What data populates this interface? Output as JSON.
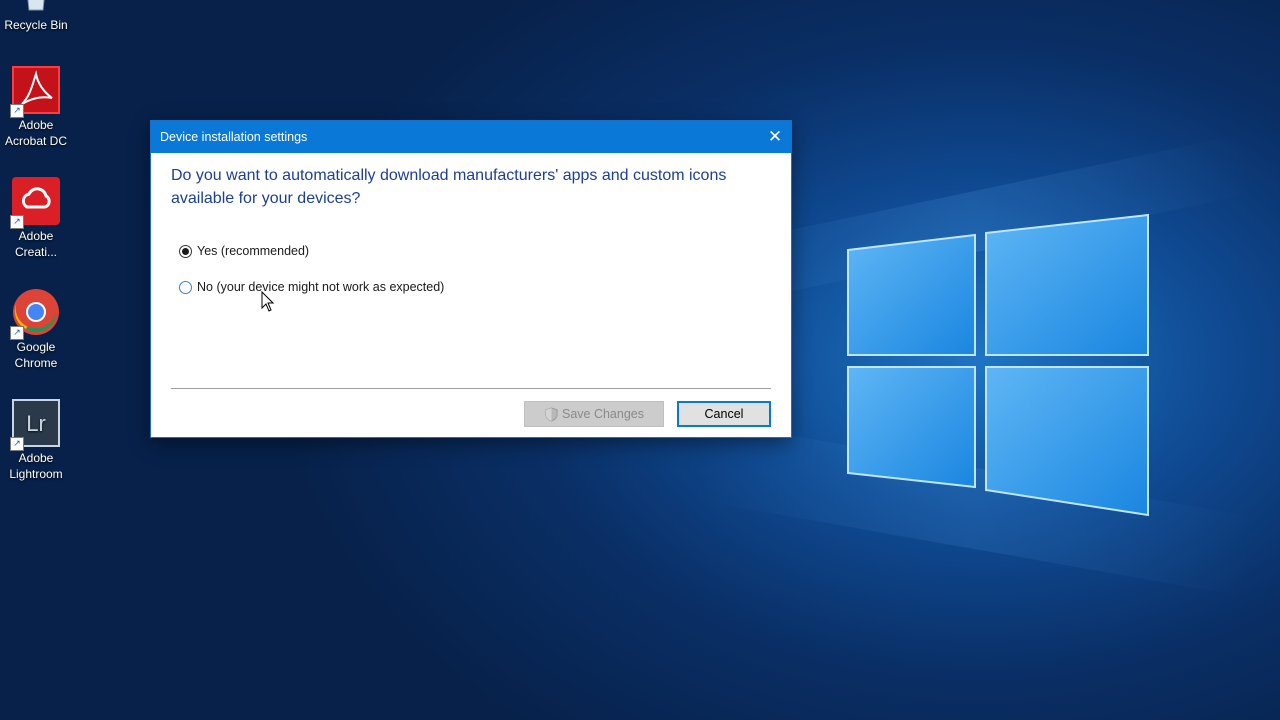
{
  "desktop": {
    "icons": [
      {
        "label_line1": "Recycle Bin",
        "label_line2": "",
        "icon": "recycle-bin-icon"
      },
      {
        "label_line1": "Adobe",
        "label_line2": "Acrobat DC",
        "icon": "adobe-acrobat-icon"
      },
      {
        "label_line1": "Adobe",
        "label_line2": "Creati...",
        "icon": "adobe-creative-cloud-icon"
      },
      {
        "label_line1": "Google",
        "label_line2": "Chrome",
        "icon": "google-chrome-icon",
        "tile_text": ""
      },
      {
        "label_line1": "Adobe",
        "label_line2": "Lightroom",
        "icon": "adobe-lightroom-icon",
        "tile_text": "Lr"
      }
    ],
    "shortcut_glyph": "↗"
  },
  "dialog": {
    "title": "Device installation settings",
    "close_glyph": "✕",
    "question": "Do you want to automatically download manufacturers' apps and custom icons available for your devices?",
    "options": [
      {
        "label": "Yes (recommended)",
        "selected": true
      },
      {
        "label": "No (your device might not work as expected)",
        "selected": false
      }
    ],
    "save_label": "Save Changes",
    "cancel_label": "Cancel"
  },
  "colors": {
    "titlebar": "#0a78d7",
    "question_text": "#1c3f94",
    "acrobat_red": "#c4121a",
    "creative_cloud_red": "#da1f26",
    "lightroom_bg": "#2b3a4a"
  }
}
